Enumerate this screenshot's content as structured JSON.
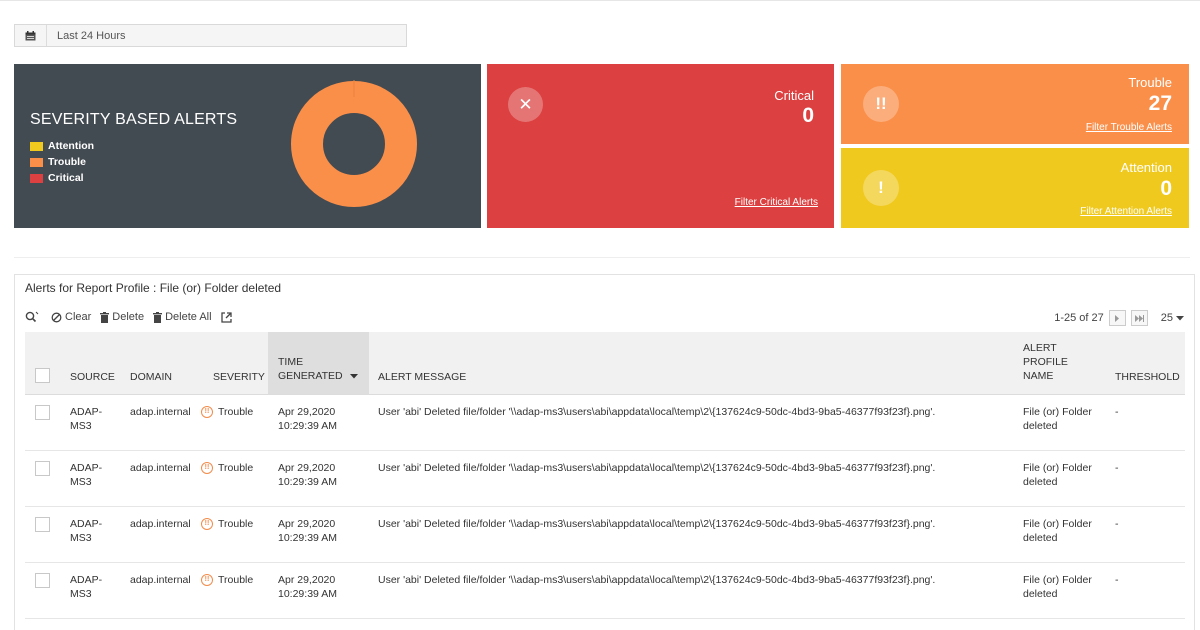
{
  "date_range": {
    "label": "Last 24 Hours"
  },
  "colors": {
    "attention": "#f0c91f",
    "trouble": "#fa8f4a",
    "critical": "#dc4040",
    "panel_dark": "#434b52"
  },
  "severity_panel": {
    "title": "SEVERITY BASED ALERTS",
    "legend": [
      {
        "label": "Attention",
        "color": "#f0c91f"
      },
      {
        "label": "Trouble",
        "color": "#fa8f4a"
      },
      {
        "label": "Critical",
        "color": "#dc4040"
      }
    ],
    "donut": {
      "attention": 0,
      "trouble": 27,
      "critical": 0
    }
  },
  "critical": {
    "name": "Critical",
    "count": "0",
    "link": "Filter Critical Alerts",
    "icon": "close-icon"
  },
  "trouble": {
    "name": "Trouble",
    "count": "27",
    "link": "Filter Trouble Alerts",
    "icon": "double-exclamation-icon"
  },
  "attention": {
    "name": "Attention",
    "count": "0",
    "link": "Filter Attention Alerts",
    "icon": "exclamation-icon"
  },
  "alerts": {
    "title": "Alerts for Report Profile : File (or) Folder deleted",
    "toolbar": {
      "clear": "Clear",
      "delete": "Delete",
      "delete_all": "Delete All"
    },
    "pager": {
      "range": "1-25 of 27",
      "page_size": "25"
    },
    "columns": {
      "source": "SOURCE",
      "domain": "DOMAIN",
      "severity": "SEVERITY",
      "time_line1": "TIME",
      "time_line2": "GENERATED",
      "message": "ALERT MESSAGE",
      "profile_line1": "ALERT",
      "profile_line2": "PROFILE",
      "profile_line3": "NAME",
      "threshold": "THRESHOLD"
    },
    "rows": [
      {
        "source_l1": "ADAP-",
        "source_l2": "MS3",
        "domain": "adap.internal",
        "severity": "Trouble",
        "time_l1": "Apr 29,2020",
        "time_l2": "10:29:39 AM",
        "message": "User 'abi' Deleted file/folder '\\\\adap-ms3\\users\\abi\\appdata\\local\\temp\\2\\{137624c9-50dc-4bd3-9ba5-46377f93f23f}.png'.",
        "profile_l1": "File (or) Folder",
        "profile_l2": "deleted",
        "threshold": "-"
      },
      {
        "source_l1": "ADAP-",
        "source_l2": "MS3",
        "domain": "adap.internal",
        "severity": "Trouble",
        "time_l1": "Apr 29,2020",
        "time_l2": "10:29:39 AM",
        "message": "User 'abi' Deleted file/folder '\\\\adap-ms3\\users\\abi\\appdata\\local\\temp\\2\\{137624c9-50dc-4bd3-9ba5-46377f93f23f}.png'.",
        "profile_l1": "File (or) Folder",
        "profile_l2": "deleted",
        "threshold": "-"
      },
      {
        "source_l1": "ADAP-",
        "source_l2": "MS3",
        "domain": "adap.internal",
        "severity": "Trouble",
        "time_l1": "Apr 29,2020",
        "time_l2": "10:29:39 AM",
        "message": "User 'abi' Deleted file/folder '\\\\adap-ms3\\users\\abi\\appdata\\local\\temp\\2\\{137624c9-50dc-4bd3-9ba5-46377f93f23f}.png'.",
        "profile_l1": "File (or) Folder",
        "profile_l2": "deleted",
        "threshold": "-"
      },
      {
        "source_l1": "ADAP-",
        "source_l2": "MS3",
        "domain": "adap.internal",
        "severity": "Trouble",
        "time_l1": "Apr 29,2020",
        "time_l2": "10:29:39 AM",
        "message": "User 'abi' Deleted file/folder '\\\\adap-ms3\\users\\abi\\appdata\\local\\temp\\2\\{137624c9-50dc-4bd3-9ba5-46377f93f23f}.png'.",
        "profile_l1": "File (or) Folder",
        "profile_l2": "deleted",
        "threshold": "-"
      }
    ]
  }
}
